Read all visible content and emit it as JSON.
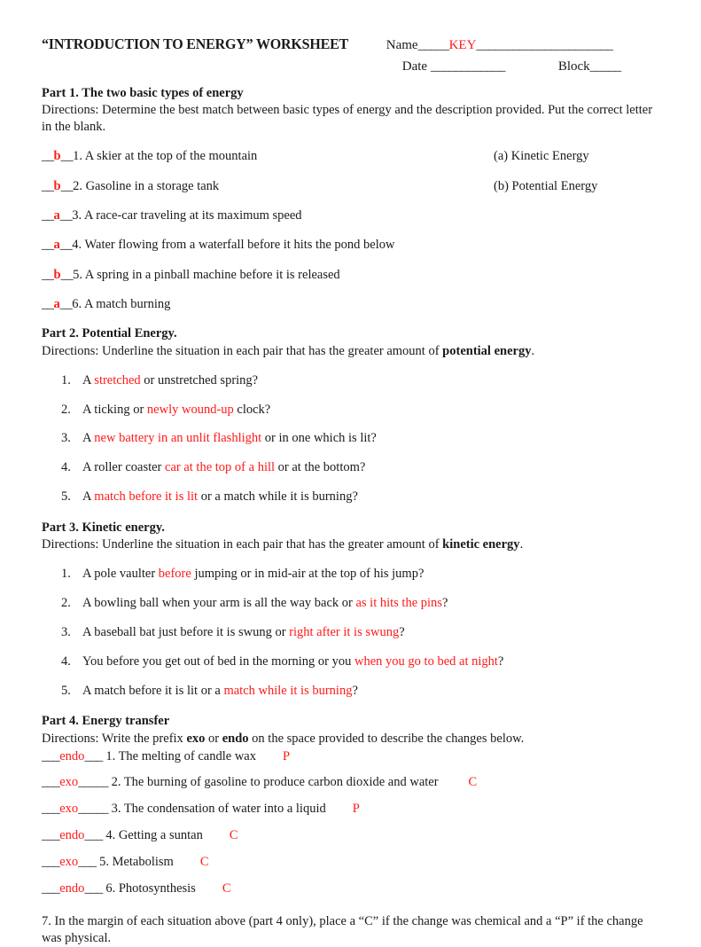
{
  "header": {
    "title": "“INTRODUCTION TO ENERGY” WORKSHEET",
    "name_label": "Name",
    "name_blank_before": "_____",
    "name_value": "KEY",
    "name_blank_after": "______________________",
    "date_label": "Date",
    "date_blank": "____________",
    "block_label": "Block",
    "block_blank": "_____"
  },
  "part1": {
    "heading": "Part 1.  The two basic types of energy",
    "directions": "Directions:  Determine the best match between basic types of energy and the description provided. Put the correct letter in the blank.",
    "blank_prefix": "__",
    "blank_suffix": "__",
    "items": [
      {
        "answer": "b",
        "number": "1.",
        "text": "A skier at the top of the mountain"
      },
      {
        "answer": "b",
        "number": "2.",
        "text": "Gasoline in a storage tank"
      },
      {
        "answer": "a",
        "number": "3.",
        "text": "A race-car traveling at its maximum speed"
      },
      {
        "answer": "a",
        "number": "4.",
        "text": "Water flowing from a waterfall before it hits the pond below"
      },
      {
        "answer": "b",
        "number": "5.",
        "text": "A spring in a pinball machine before it is released"
      },
      {
        "answer": "a",
        "number": "6.",
        "text": "A match burning"
      }
    ],
    "options": [
      "(a) Kinetic Energy",
      "(b) Potential Energy"
    ]
  },
  "part2": {
    "heading": "Part 2.  Potential Energy.",
    "directions_pre": "Directions: Underline the situation in each pair that has the greater amount of ",
    "directions_bold": "potential energy",
    "directions_post": ".",
    "items": [
      {
        "pre": " A ",
        "answer": "stretched",
        "post": " or unstretched spring?"
      },
      {
        "pre": "A ticking or ",
        "answer": "newly wound-up",
        "post": " clock?"
      },
      {
        "pre": "A ",
        "answer": "new battery in an unlit flashlight",
        "post": " or in one which is lit?"
      },
      {
        "pre": "A roller coaster ",
        "answer": "car at the top of a hill",
        "post": " or at the bottom?"
      },
      {
        "pre": "A ",
        "answer": "match before it is lit",
        "post": " or a match while it is burning?"
      }
    ]
  },
  "part3": {
    "heading": "Part 3.  Kinetic energy.",
    "directions_pre": "Directions: Underline the situation in each pair that has the greater amount of ",
    "directions_bold": "kinetic energy",
    "directions_post": ".",
    "items": [
      {
        "pre": " A pole vaulter ",
        "answer": "before",
        "post": " jumping or in mid-air at the top of his jump?"
      },
      {
        "pre": "A bowling ball when your arm is all the way back or ",
        "answer": "as it hits the pins",
        "post": "?"
      },
      {
        "pre": "A baseball bat just before it is swung or ",
        "answer": "right after it is swung",
        "post": "?"
      },
      {
        "pre": "You before you get out of bed in the morning or you ",
        "answer": "when you go to bed at night",
        "post": "?"
      },
      {
        "pre": "A match before it is lit or a ",
        "answer": "match while it is burning",
        "post": "?"
      }
    ]
  },
  "part4": {
    "heading": "Part 4.  Energy transfer",
    "directions_pre": "Directions: Write the prefix ",
    "directions_bold1": "exo",
    "directions_mid": " or ",
    "directions_bold2": "endo",
    "directions_post": " on the space provided to describe the changes below.",
    "items": [
      {
        "blank_before": "___",
        "answer": "endo",
        "blank_after": "___",
        "number": "1.",
        "text": "The melting of candle wax",
        "mark": "P"
      },
      {
        "blank_before": "___",
        "answer": "exo",
        "blank_after": "_____",
        "number": "2.",
        "text": "The burning of gasoline to produce carbon dioxide and water",
        "mark": "C"
      },
      {
        "blank_before": "___",
        "answer": "exo",
        "blank_after": "_____",
        "number": "3.",
        "text": "The condensation of water into a liquid",
        "mark": "P"
      },
      {
        "blank_before": "___",
        "answer": "endo",
        "blank_after": "___",
        "number": "4.",
        "text": "Getting a suntan",
        "mark": "C"
      },
      {
        "blank_before": "___",
        "answer": "exo",
        "blank_after": "___",
        "number": "5.",
        "text": "Metabolism",
        "mark": "C"
      },
      {
        "blank_before": "___",
        "answer": "endo",
        "blank_after": "___",
        "number": "6.",
        "text": "Photosynthesis",
        "mark": "C"
      }
    ]
  },
  "closing": {
    "text": "7.   In the margin of each situation above (part 4 only), place a “C” if the change was chemical and a “P” if the change was physical."
  },
  "colors": {
    "answer_red": "#ff1a1a",
    "text_black": "#1a1a1a",
    "page_background": "#ffffff"
  }
}
